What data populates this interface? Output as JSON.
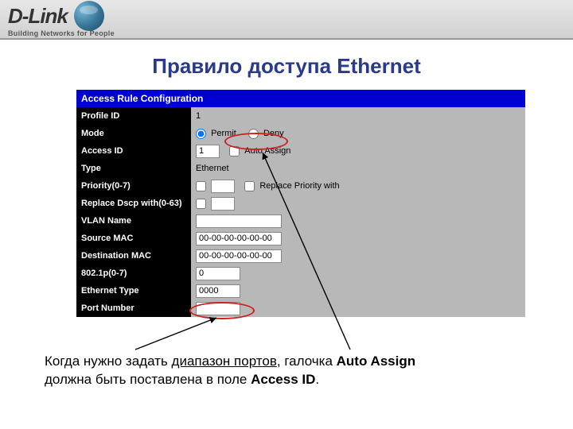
{
  "header": {
    "brand": "D-Link",
    "tagline": "Building Networks for People"
  },
  "title": "Правило доступа Ethernet",
  "panel": {
    "heading": "Access Rule Configuration",
    "rows": {
      "profile_id": {
        "label": "Profile ID",
        "value": "1"
      },
      "mode": {
        "label": "Mode",
        "permit": "Permit",
        "deny": "Deny"
      },
      "access_id": {
        "label": "Access ID",
        "value": "1",
        "auto_assign": "Auto Assign"
      },
      "type": {
        "label": "Type",
        "value": "Ethernet"
      },
      "priority": {
        "label": "Priority(0-7)",
        "value": "",
        "replace": "Replace Priority with"
      },
      "dscp": {
        "label": "Replace Dscp with(0-63)",
        "value": ""
      },
      "vlan": {
        "label": "VLAN Name",
        "value": ""
      },
      "src_mac": {
        "label": "Source MAC",
        "value": "00-00-00-00-00-00"
      },
      "dst_mac": {
        "label": "Destination MAC",
        "value": "00-00-00-00-00-00"
      },
      "dot1p": {
        "label": "802.1p(0-7)",
        "value": "0"
      },
      "eth_type": {
        "label": "Ethernet Type",
        "value": "0000"
      },
      "port_num": {
        "label": "Port Number",
        "value": ""
      }
    }
  },
  "caption": {
    "part1": "Когда нужно задать ",
    "port_range": "диапазон портов",
    "part2": ", галочка ",
    "auto_assign": "Auto Assign",
    "part3": "должна быть поставлена в поле ",
    "access_id": "Access ID",
    "part4": "."
  }
}
